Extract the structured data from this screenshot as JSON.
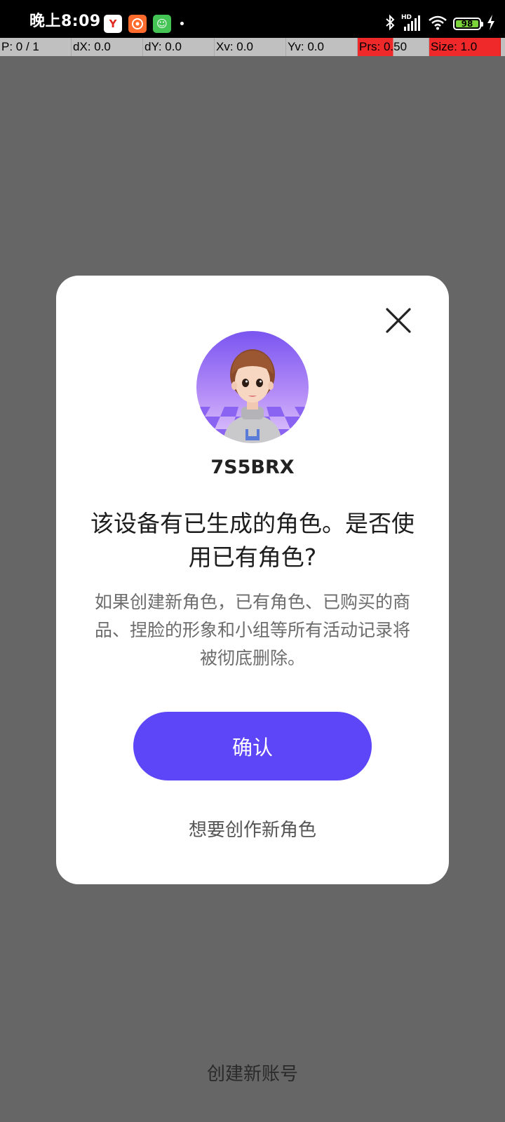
{
  "status_bar": {
    "time": "晚上8:09",
    "app_icons": [
      "Y",
      "",
      "☺"
    ],
    "battery": "98",
    "hd_label": "HD"
  },
  "debug_bar": {
    "pointers": "P: 0 / 1",
    "dx": "dX: 0.0",
    "dy": "dY: 0.0",
    "xv": "Xv: 0.0",
    "yv": "Yv: 0.0",
    "prs": "Prs: 0.50",
    "size": "Size: 1.0"
  },
  "dialog": {
    "username": "7S5BRX",
    "title": "该设备有已生成的角色。是否使用已有角色?",
    "description": "如果创建新角色，已有角色、已购买的商品、捏脸的形象和小组等所有活动记录将被彻底删除。",
    "confirm_label": "确认",
    "create_character_label": "想要创作新角色"
  },
  "footer": {
    "create_account_label": "创建新账号"
  },
  "colors": {
    "overlay": "#666666",
    "accent": "#5d46f7",
    "alert_red": "#ef2929"
  },
  "icons": {
    "close": "close-icon",
    "bluetooth": "bluetooth-icon",
    "signal": "signal-icon",
    "wifi": "wifi-icon",
    "charging": "charging-icon"
  }
}
